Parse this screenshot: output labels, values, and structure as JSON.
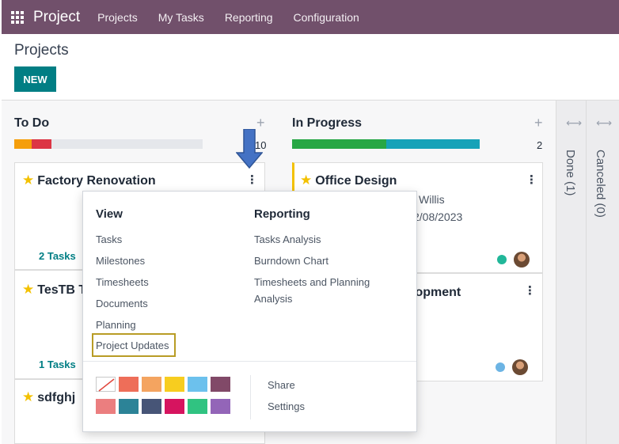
{
  "topbar": {
    "brand": "Project",
    "menu": [
      "Projects",
      "My Tasks",
      "Reporting",
      "Configuration"
    ]
  },
  "control": {
    "title": "Projects",
    "new_label": "NEW"
  },
  "columns": {
    "todo": {
      "title": "To Do",
      "count": "10"
    },
    "inprogress": {
      "title": "In Progress",
      "count": "2"
    },
    "done": {
      "title": "Done (1)"
    },
    "canceled": {
      "title": "Canceled (0)"
    }
  },
  "cards": {
    "factory": {
      "title": "Factory Renovation",
      "tasks": "2 Tasks"
    },
    "testb": {
      "title": "TesTB T",
      "tasks": "1 Tasks"
    },
    "sdfghj": {
      "title": "sdfghj"
    },
    "office": {
      "title": "Office Design",
      "manager": "l Willis",
      "date": "2/08/2023"
    },
    "dev": {
      "title": "lopment"
    }
  },
  "dropdown": {
    "view_header": "View",
    "view_items": [
      "Tasks",
      "Milestones",
      "Timesheets",
      "Documents",
      "Planning",
      "Project Updates"
    ],
    "reporting_header": "Reporting",
    "reporting_items": [
      "Tasks Analysis",
      "Burndown Chart",
      "Timesheets and Planning",
      "Analysis"
    ],
    "actions": [
      "Share",
      "Settings"
    ],
    "colors": [
      "#ffffff",
      "#ee6e59",
      "#f4a460",
      "#f7cd1f",
      "#6cc1ed",
      "#814968",
      "#eb7e7f",
      "#2c8397",
      "#475577",
      "#d6145f",
      "#30c381",
      "#9365b8"
    ]
  },
  "colors": {
    "topbar": "#71506b",
    "primary": "#017e84"
  }
}
